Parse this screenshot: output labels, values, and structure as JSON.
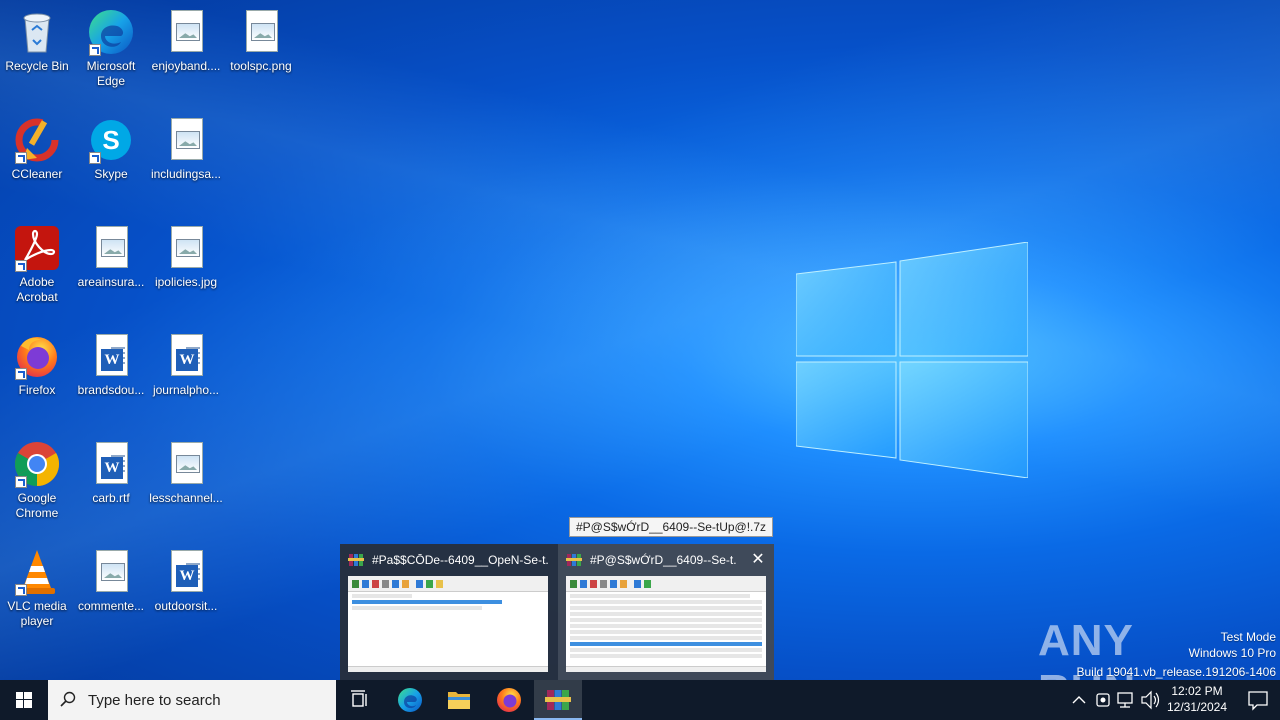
{
  "desktop": {
    "icons": [
      {
        "label": "Recycle Bin"
      },
      {
        "label": "Microsoft Edge"
      },
      {
        "label": "enjoyband...."
      },
      {
        "label": "toolspc.png"
      },
      {
        "label": "CCleaner"
      },
      {
        "label": "Skype"
      },
      {
        "label": "includingsa..."
      },
      {
        "label": "Adobe Acrobat"
      },
      {
        "label": "areainsura..."
      },
      {
        "label": "ipolicies.jpg"
      },
      {
        "label": "Firefox"
      },
      {
        "label": "brandsdou..."
      },
      {
        "label": "journalpho..."
      },
      {
        "label": "Google Chrome"
      },
      {
        "label": "carb.rtf"
      },
      {
        "label": "lesschannel..."
      },
      {
        "label": "VLC media player"
      },
      {
        "label": "commente..."
      },
      {
        "label": "outdoorsit..."
      }
    ]
  },
  "tooltip": "#P@S$wỚrD__6409--Se-tUp@!.7z",
  "thumbnails": [
    {
      "title": "#Pa$$CŌDe--6409__OpeN-Se-t..."
    },
    {
      "title": "#P@S$wỚrD__6409--Se-t..."
    }
  ],
  "watermark": {
    "brand": "ANY RUN",
    "test_mode": "Test Mode",
    "edition": "Windows 10 Pro",
    "build": "Build 19041.vb_release.191206-1406"
  },
  "taskbar": {
    "search_placeholder": "Type here to search",
    "time": "12:02 PM",
    "date": "12/31/2024"
  },
  "colors": {
    "taskbar": "#0f1a2a",
    "desktop_accent": "#0a6ae6"
  }
}
